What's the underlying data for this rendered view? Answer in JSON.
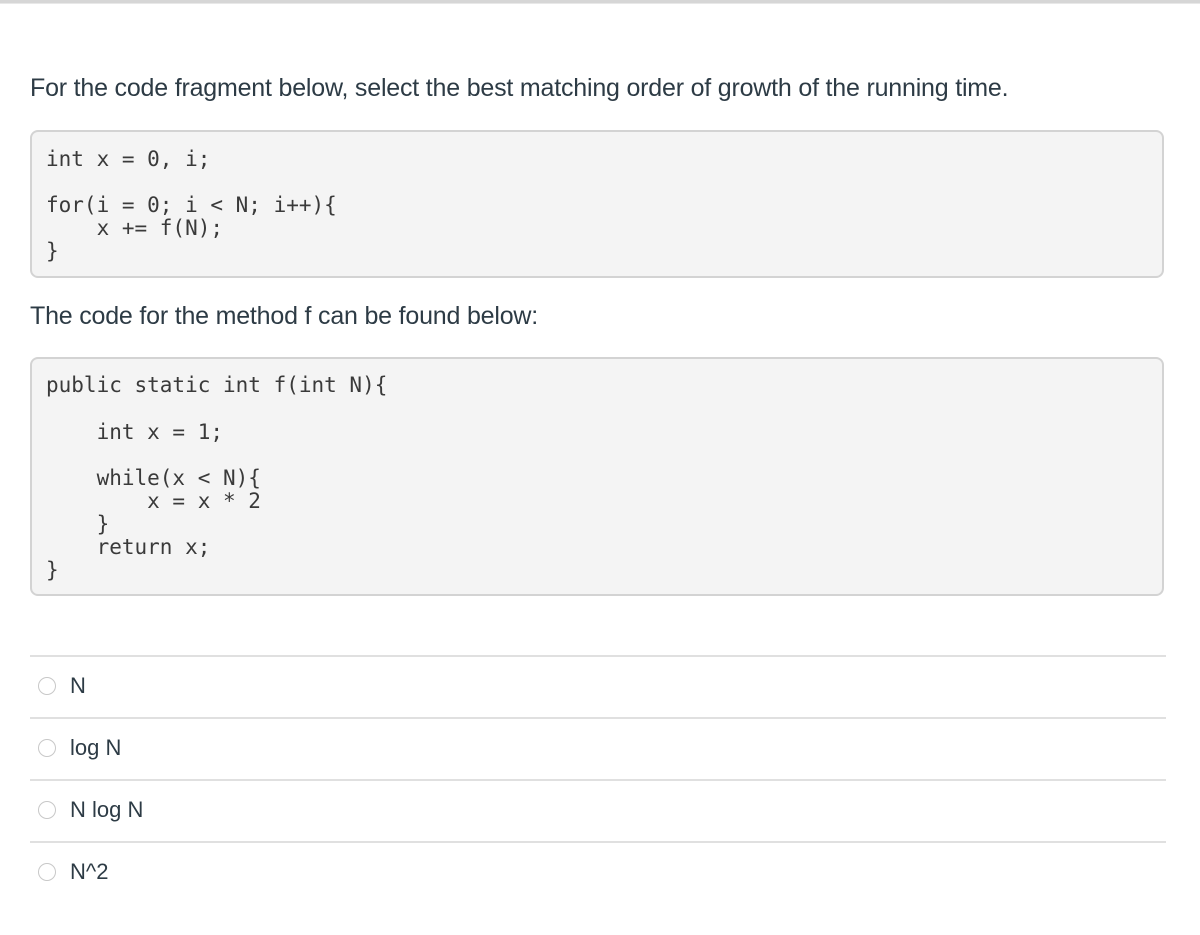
{
  "question": {
    "prompt": "For the code fragment below, select the best matching order of growth of the running time.",
    "code_fragment": [
      "int x = 0, i;",
      "for(i = 0; i < N; i++){",
      "    x += f(N);",
      "}"
    ],
    "method_intro": "The code for the method f can be found below:",
    "method_code": [
      "public static int f(int N){",
      "    int x = 1;",
      "    while(x < N){",
      "        x = x * 2",
      "    }",
      "    return x;",
      "}"
    ]
  },
  "answers": [
    {
      "label": "N",
      "selected": false
    },
    {
      "label": "log N",
      "selected": false
    },
    {
      "label": "N log N",
      "selected": false
    },
    {
      "label": "N^2",
      "selected": false
    }
  ]
}
